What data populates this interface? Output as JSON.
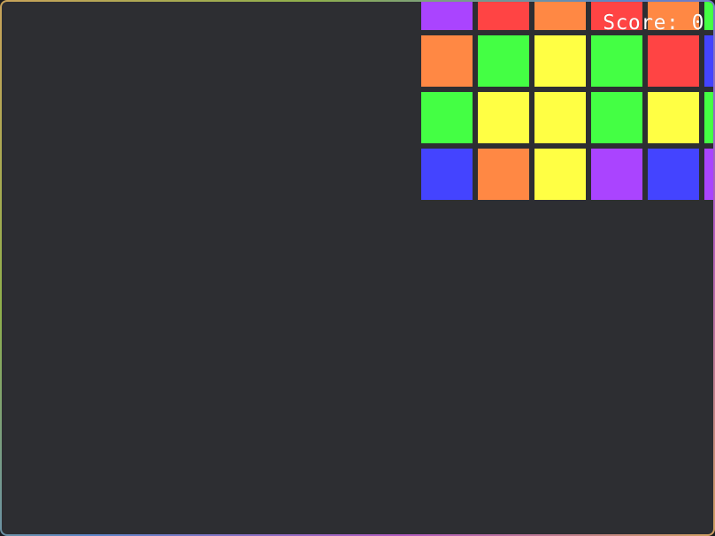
{
  "game": {
    "score_label": "Score: 0",
    "score": 0
  },
  "palette": {
    "purple": "#aa44ff",
    "red": "#ff4444",
    "orange": "#ff8844",
    "green": "#44ff44",
    "yellow": "#ffff44",
    "blue": "#4444ff",
    "background": "#2d2e32"
  },
  "board": {
    "rows": [
      [
        "purple",
        "red",
        "orange",
        "red",
        "orange",
        "green"
      ],
      [
        "orange",
        "green",
        "yellow",
        "green",
        "red",
        "blue"
      ],
      [
        "green",
        "yellow",
        "yellow",
        "green",
        "yellow",
        "green"
      ],
      [
        "blue",
        "orange",
        "yellow",
        "purple",
        "blue",
        "purple"
      ]
    ]
  }
}
